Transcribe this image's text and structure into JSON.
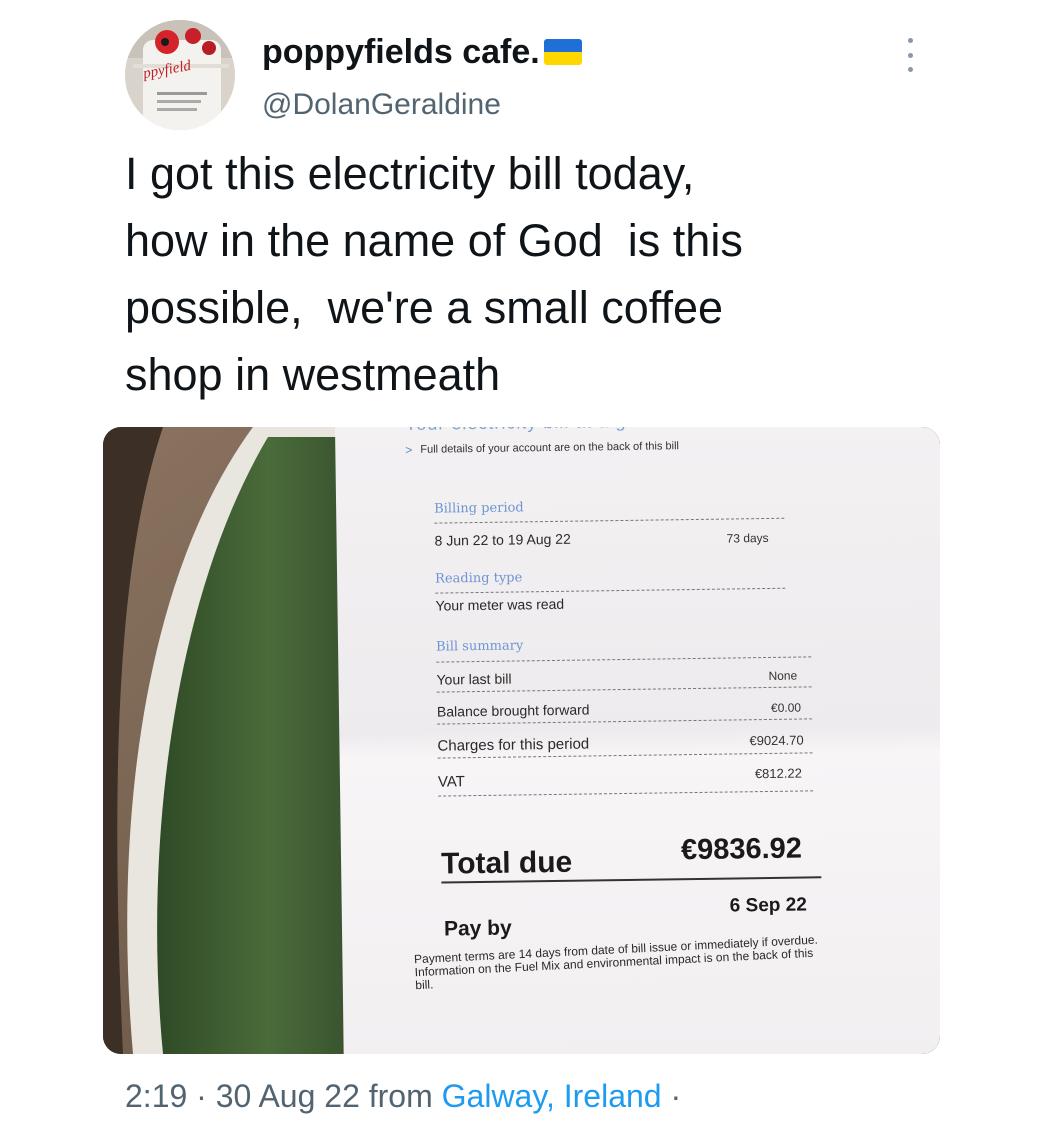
{
  "author": {
    "display_name": "poppyfields cafe.",
    "handle": "@DolanGeraldine",
    "avatar_text": "ppyfield"
  },
  "tweet_text": "I got this electricity bill today,\nhow in the name of God  is this\npossible,  we're a small coffee\nshop in westmeath",
  "bill": {
    "heading": "Your electricity bill at a glance",
    "details_note": "Full details of your account are on the back of this bill",
    "billing_period_label": "Billing period",
    "billing_period": "8 Jun 22 to 19 Aug 22",
    "days": "73 days",
    "reading_type_label": "Reading type",
    "reading_type": "Your meter was read",
    "bill_summary_label": "Bill summary",
    "rows": [
      {
        "label": "Your last bill",
        "value": "None"
      },
      {
        "label": "Balance brought forward",
        "value": "€0.00"
      },
      {
        "label": "Charges for this period",
        "value": "€9024.70"
      },
      {
        "label": "VAT",
        "value": "€812.22"
      }
    ],
    "total_label": "Total due",
    "total_value": "€9836.92",
    "pay_by_label": "Pay by",
    "pay_by_date": "6 Sep 22",
    "terms": "Payment terms are 14 days from date of bill issue or immediately if overdue. Information on the Fuel Mix and environmental impact is on the back of this bill."
  },
  "meta": {
    "time": "2:19",
    "date": "30 Aug 22",
    "from_label": "from",
    "location": "Galway, Ireland",
    "sep": "·"
  },
  "colors": {
    "flag_blue": "#1f6fd6",
    "flag_yellow": "#ffd700",
    "link": "#1d9bf0",
    "bill_label_blue": "#6d95d2"
  },
  "icons": [
    "ukraine-flag-icon",
    "more-options-icon"
  ]
}
